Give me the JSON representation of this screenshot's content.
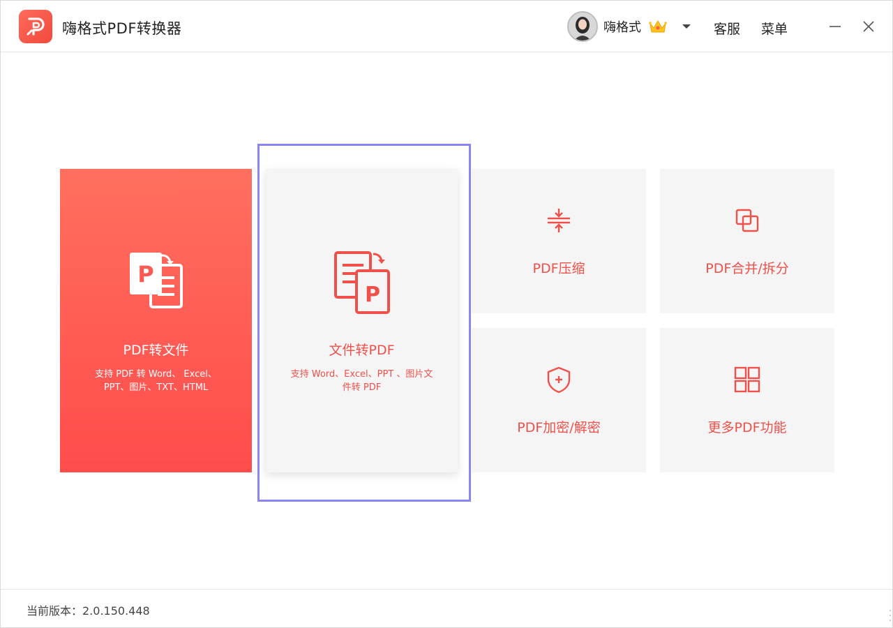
{
  "app": {
    "title": "嗨格式PDF转换器"
  },
  "header": {
    "username": "嗨格式",
    "support_label": "客服",
    "menu_label": "菜单"
  },
  "cards": {
    "pdf_to_file": {
      "title": "PDF转文件",
      "desc": "支持 PDF 转 Word、 Excel、 PPT、图片、TXT、HTML",
      "icon": "pdf-to-file-icon"
    },
    "file_to_pdf": {
      "title": "文件转PDF",
      "desc": "支持 Word、Excel、PPT 、图片文件转 PDF",
      "icon": "file-to-pdf-icon"
    },
    "compress": {
      "title": "PDF压缩",
      "icon": "compress-icon"
    },
    "merge_split": {
      "title": "PDF合并/拆分",
      "icon": "merge-icon"
    },
    "encrypt": {
      "title": "PDF加密/解密",
      "icon": "shield-icon"
    },
    "more": {
      "title": "更多PDF功能",
      "icon": "grid-icon"
    }
  },
  "footer": {
    "version": "当前版本：2.0.150.448"
  },
  "colors": {
    "accent": "#f0504a",
    "primary_card_top": "#ff6f5e",
    "primary_card_bottom": "#ff4c4c",
    "selection": "#8a85f2",
    "card_bg": "#f5f5f5"
  }
}
